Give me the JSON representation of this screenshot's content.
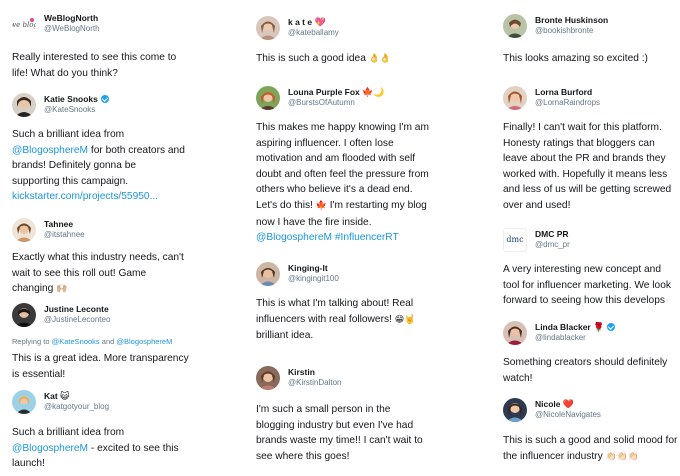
{
  "columns": [
    {
      "tweets": [
        {
          "name": "WeBlogNorth",
          "handle": "@WeBlogNorth",
          "avatar": "webblognorth-logo",
          "lines": [
            "Really interested to see this come to",
            "life! What do you think?"
          ]
        },
        {
          "name": "Katie Snooks",
          "handle": "@KateSnooks",
          "verified": true,
          "lines_html_parts": {
            "l1": "Such a brilliant idea from",
            "mention": "@BlogosphereM",
            "l2_tail": " for both creators and",
            "l3": "brands! Definitely gonna be",
            "l4": "supporting this campaign.",
            "link": "kickstarter.com/projects/55950..."
          }
        },
        {
          "name": "Tahnee",
          "handle": "@itstahnee",
          "lines": [
            "Exactly what this industry needs, can't",
            "wait to see this roll out! Game",
            "changing"
          ],
          "emoji": "🙌🏼"
        },
        {
          "name": "Justine Leconte",
          "handle": "@JustineLeconteo",
          "reply_prefix": "Replying to",
          "reply_to_1": "@KateSnooks",
          "reply_and": " and ",
          "reply_to_2": "@BlogosphereM",
          "lines": [
            "This is a great idea. More transparency",
            "is essential!"
          ]
        },
        {
          "name": "Kat",
          "name_emoji": "😺",
          "handle": "@katgotyour_blog",
          "line1": "Such a brilliant idea from",
          "mention": "@BlogosphereM",
          "line2_tail": " - excited to see this",
          "line3": "launch!"
        }
      ]
    },
    {
      "tweets": [
        {
          "name": "k a t e",
          "name_emoji": "💖",
          "handle": "@kateballamy",
          "line": "This is such a good idea",
          "emoji": "👌👌"
        },
        {
          "name": "Louna Purple Fox",
          "name_emoji": "🍁🌙",
          "handle": "@BurstsOfAutumn",
          "lines": [
            "This makes me happy knowing I'm am",
            "aspiring influencer. I often lose",
            "motivation and am flooded with self",
            "doubt and often feel the pressure from",
            "others who believe it's a dead end."
          ],
          "line6a": "Let's do this!",
          "line6_emoji": "🍁",
          "line6b": " I'm restarting my blog",
          "line7": "now I have the fire inside.",
          "tags": "@BlogosphereM #InfluencerRT"
        },
        {
          "name": "Kinging-It",
          "handle": "@kingingit100",
          "line1": "This is what I'm talking about! Real",
          "line2": "influencers with real followers!",
          "line2_emoji": "😁🤘",
          "line3": "brilliant idea."
        },
        {
          "name": "Kirstin",
          "handle": "@KirstinDalton",
          "lines": [
            "I'm such a small person in the",
            "blogging industry but even I've had",
            "brands waste my time!! I can't wait to",
            "see where this goes!"
          ]
        }
      ]
    },
    {
      "tweets": [
        {
          "name": "Bronte Huskinson",
          "handle": "@bookishbronte",
          "lines": [
            "This looks amazing so excited :)"
          ]
        },
        {
          "name": "Lorna Burford",
          "handle": "@LornaRaindrops",
          "lines": [
            "Finally! I can't wait for this platform.",
            "Honesty ratings that bloggers can",
            "leave about the PR and brands they",
            "worked with. Hopefully it means less",
            "and less of us will be getting screwed",
            "over and used!"
          ]
        },
        {
          "name": "DMC PR",
          "handle": "@dmc_pr",
          "avatar_text": "dmc",
          "lines": [
            "A very interesting new concept and",
            "tool for influencer marketing. We look",
            "forward to seeing how this develops"
          ]
        },
        {
          "name": "Linda Blacker",
          "name_emoji": "🌹",
          "verified": true,
          "handle": "@lindablacker",
          "lines": [
            "Something creators should definitely",
            "watch!"
          ]
        },
        {
          "name": "Nicole",
          "name_emoji": "❤️",
          "handle": "@NicoleNavigates",
          "lines": [
            "This is such a good and solid mood for",
            "the influencer industry"
          ],
          "emoji": "👏🏻👏🏻👏🏻"
        }
      ]
    }
  ]
}
